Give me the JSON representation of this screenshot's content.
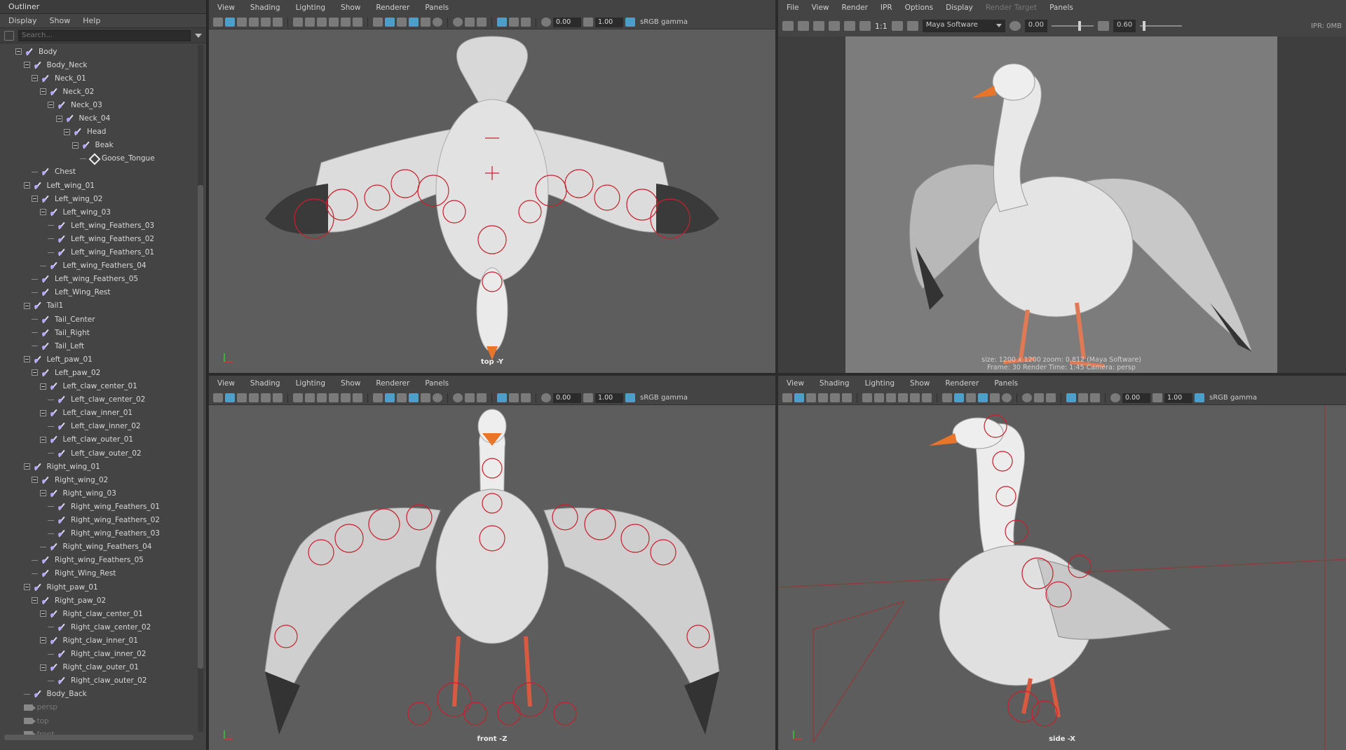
{
  "outliner": {
    "title": "Outliner",
    "menu": [
      "Display",
      "Show",
      "Help"
    ],
    "search_placeholder": "Search...",
    "nodes": [
      {
        "label": "Body",
        "depth": 1,
        "type": "joint",
        "exp": true
      },
      {
        "label": "Body_Neck",
        "depth": 2,
        "type": "joint",
        "exp": true
      },
      {
        "label": "Neck_01",
        "depth": 3,
        "type": "joint",
        "exp": true
      },
      {
        "label": "Neck_02",
        "depth": 4,
        "type": "joint",
        "exp": true
      },
      {
        "label": "Neck_03",
        "depth": 5,
        "type": "joint",
        "exp": true
      },
      {
        "label": "Neck_04",
        "depth": 6,
        "type": "joint",
        "exp": true
      },
      {
        "label": "Head",
        "depth": 7,
        "type": "joint",
        "exp": true
      },
      {
        "label": "Beak",
        "depth": 8,
        "type": "joint",
        "exp": true
      },
      {
        "label": "Goose_Tongue",
        "depth": 9,
        "type": "mesh",
        "exp": false
      },
      {
        "label": "Chest",
        "depth": 3,
        "type": "joint",
        "exp": false
      },
      {
        "label": "Left_wing_01",
        "depth": 2,
        "type": "joint",
        "exp": true
      },
      {
        "label": "Left_wing_02",
        "depth": 3,
        "type": "joint",
        "exp": true
      },
      {
        "label": "Left_wing_03",
        "depth": 4,
        "type": "joint",
        "exp": true
      },
      {
        "label": "Left_wing_Feathers_03",
        "depth": 5,
        "type": "joint",
        "exp": false
      },
      {
        "label": "Left_wing_Feathers_02",
        "depth": 5,
        "type": "joint",
        "exp": false
      },
      {
        "label": "Left_wing_Feathers_01",
        "depth": 5,
        "type": "joint",
        "exp": false
      },
      {
        "label": "Left_wing_Feathers_04",
        "depth": 4,
        "type": "joint",
        "exp": false
      },
      {
        "label": "Left_wing_Feathers_05",
        "depth": 3,
        "type": "joint",
        "exp": false
      },
      {
        "label": "Left_Wing_Rest",
        "depth": 3,
        "type": "joint",
        "exp": false
      },
      {
        "label": "Tail1",
        "depth": 2,
        "type": "joint",
        "exp": true
      },
      {
        "label": "Tail_Center",
        "depth": 3,
        "type": "joint",
        "exp": false
      },
      {
        "label": "Tail_Right",
        "depth": 3,
        "type": "joint",
        "exp": false
      },
      {
        "label": "Tail_Left",
        "depth": 3,
        "type": "joint",
        "exp": false
      },
      {
        "label": "Left_paw_01",
        "depth": 2,
        "type": "joint",
        "exp": true
      },
      {
        "label": "Left_paw_02",
        "depth": 3,
        "type": "joint",
        "exp": true
      },
      {
        "label": "Left_claw_center_01",
        "depth": 4,
        "type": "joint",
        "exp": true
      },
      {
        "label": "Left_claw_center_02",
        "depth": 5,
        "type": "joint",
        "exp": false
      },
      {
        "label": "Left_claw_inner_01",
        "depth": 4,
        "type": "joint",
        "exp": true
      },
      {
        "label": "Left_claw_inner_02",
        "depth": 5,
        "type": "joint",
        "exp": false
      },
      {
        "label": "Left_claw_outer_01",
        "depth": 4,
        "type": "joint",
        "exp": true
      },
      {
        "label": "Left_claw_outer_02",
        "depth": 5,
        "type": "joint",
        "exp": false
      },
      {
        "label": "Right_wing_01",
        "depth": 2,
        "type": "joint",
        "exp": true
      },
      {
        "label": "Right_wing_02",
        "depth": 3,
        "type": "joint",
        "exp": true
      },
      {
        "label": "Right_wing_03",
        "depth": 4,
        "type": "joint",
        "exp": true
      },
      {
        "label": "Right_wing_Feathers_01",
        "depth": 5,
        "type": "joint",
        "exp": false
      },
      {
        "label": "Right_wing_Feathers_02",
        "depth": 5,
        "type": "joint",
        "exp": false
      },
      {
        "label": "Right_wing_Feathers_03",
        "depth": 5,
        "type": "joint",
        "exp": false
      },
      {
        "label": "Right_wing_Feathers_04",
        "depth": 4,
        "type": "joint",
        "exp": false
      },
      {
        "label": "Right_wing_Feathers_05",
        "depth": 3,
        "type": "joint",
        "exp": false
      },
      {
        "label": "Right_Wing_Rest",
        "depth": 3,
        "type": "joint",
        "exp": false
      },
      {
        "label": "Right_paw_01",
        "depth": 2,
        "type": "joint",
        "exp": true
      },
      {
        "label": "Right_paw_02",
        "depth": 3,
        "type": "joint",
        "exp": true
      },
      {
        "label": "Right_claw_center_01",
        "depth": 4,
        "type": "joint",
        "exp": true
      },
      {
        "label": "Right_claw_center_02",
        "depth": 5,
        "type": "joint",
        "exp": false
      },
      {
        "label": "Right_claw_inner_01",
        "depth": 4,
        "type": "joint",
        "exp": true
      },
      {
        "label": "Right_claw_inner_02",
        "depth": 5,
        "type": "joint",
        "exp": false
      },
      {
        "label": "Right_claw_outer_01",
        "depth": 4,
        "type": "joint",
        "exp": true
      },
      {
        "label": "Right_claw_outer_02",
        "depth": 5,
        "type": "joint",
        "exp": false
      },
      {
        "label": "Body_Back",
        "depth": 2,
        "type": "joint",
        "exp": false
      },
      {
        "label": "persp",
        "depth": 2,
        "type": "camera",
        "exp": false
      },
      {
        "label": "top",
        "depth": 2,
        "type": "camera",
        "exp": false
      },
      {
        "label": "front",
        "depth": 2,
        "type": "camera",
        "exp": false
      }
    ]
  },
  "viewport_menu": [
    "View",
    "Shading",
    "Lighting",
    "Show",
    "Renderer",
    "Panels"
  ],
  "viewport_toolbar": {
    "field_a": "0.00",
    "field_b": "1.00",
    "gamma": "sRGB gamma"
  },
  "viewports": {
    "top": {
      "label": "top -Y"
    },
    "front": {
      "label": "front -Z"
    },
    "side": {
      "label": "side -X"
    }
  },
  "render_view": {
    "menu": [
      "File",
      "View",
      "Render",
      "IPR",
      "Options",
      "Display",
      "Render Target",
      "Panels"
    ],
    "ratio": "1:1",
    "renderer": "Maya Software",
    "exposure": "0.00",
    "gamma": "0.60",
    "ipr": "IPR: 0MB",
    "info_line1": "size: 1200 x 1200 zoom: 0.812      (Maya Software)",
    "info_line2": "Frame: 30      Render Time: 1:45        Camera: persp"
  },
  "colors": {
    "accent": "#4b9fc8",
    "rig": "#c8202c",
    "beak": "#e8752a",
    "viewport_bg": "#5d5d5d"
  }
}
